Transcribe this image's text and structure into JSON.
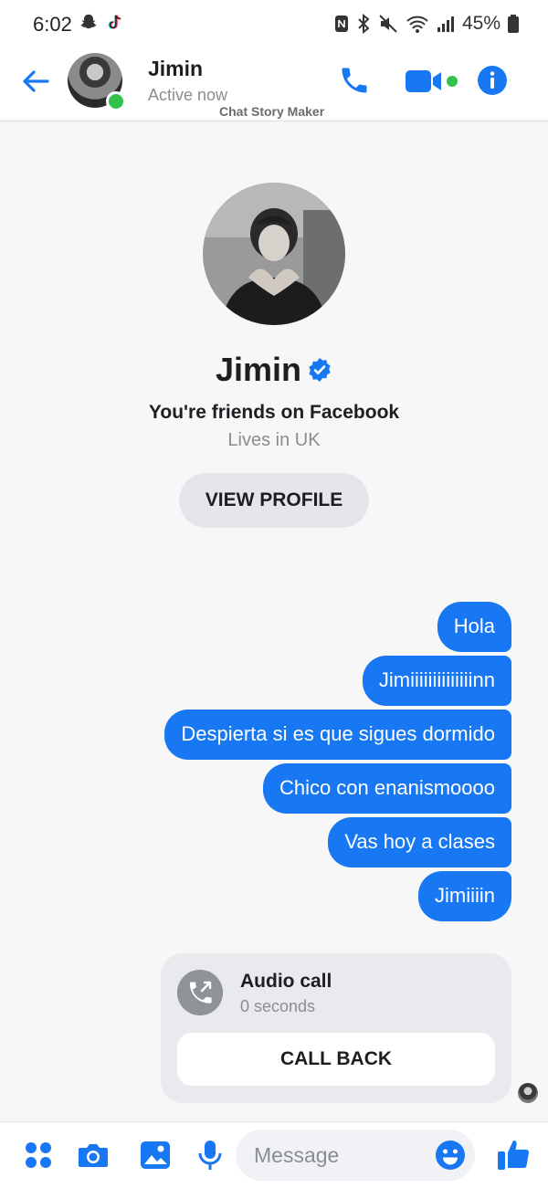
{
  "status_bar": {
    "time": "6:02",
    "battery_text": "45%",
    "left_icons": [
      "snapchat-icon",
      "tiktok-icon"
    ],
    "right_icons": [
      "nfc-icon",
      "bluetooth-icon",
      "mute-icon",
      "wifi-icon",
      "signal-icon",
      "battery-icon"
    ]
  },
  "header": {
    "name": "Jimin",
    "status": "Active now",
    "watermark": "Chat Story Maker",
    "icons": [
      "back-arrow-icon",
      "phone-icon",
      "video-camera-icon",
      "info-icon"
    ]
  },
  "profile": {
    "name": "Jimin",
    "friends_text": "You're friends on Facebook",
    "location_text": "Lives in UK",
    "view_profile_label": "VIEW PROFILE"
  },
  "messages": [
    {
      "text": "Hola"
    },
    {
      "text": "Jimiiiiiiiiiiiiiinn"
    },
    {
      "text": "Despierta si es que sigues dormido"
    },
    {
      "text": "Chico con enanismoooo"
    },
    {
      "text": "Vas hoy a clases"
    },
    {
      "text": "Jimiiiin"
    }
  ],
  "call_card": {
    "title": "Audio call",
    "subtitle": "0 seconds",
    "button_label": "CALL BACK"
  },
  "composer": {
    "placeholder": "Message",
    "icons": [
      "menu-dots-icon",
      "camera-icon",
      "gallery-icon",
      "microphone-icon",
      "emoji-icon",
      "thumbs-up-icon"
    ]
  },
  "colors": {
    "accent": "#1877f2",
    "online": "#31c24c",
    "background": "#f7f7f8"
  }
}
